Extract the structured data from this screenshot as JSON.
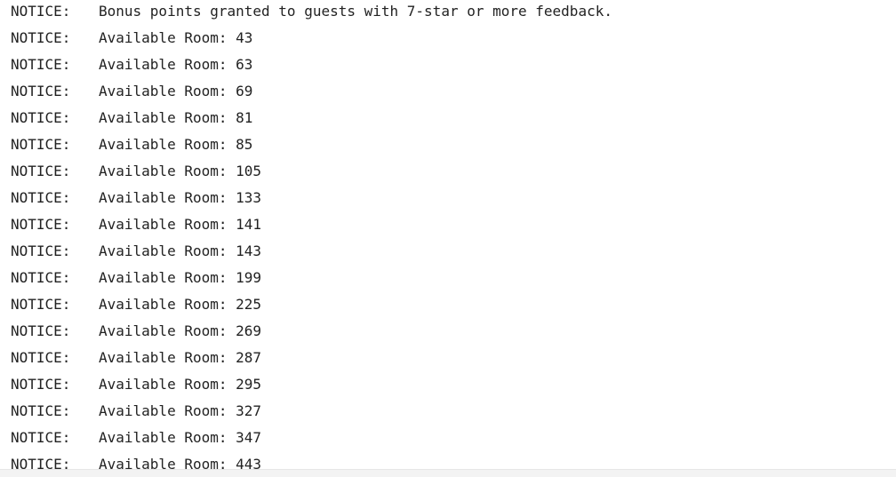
{
  "log": {
    "lines": [
      {
        "level": "NOTICE:",
        "message": "Bonus points granted to guests with 7-star or more feedback."
      },
      {
        "level": "NOTICE:",
        "message": "Available Room: 43"
      },
      {
        "level": "NOTICE:",
        "message": "Available Room: 63"
      },
      {
        "level": "NOTICE:",
        "message": "Available Room: 69"
      },
      {
        "level": "NOTICE:",
        "message": "Available Room: 81"
      },
      {
        "level": "NOTICE:",
        "message": "Available Room: 85"
      },
      {
        "level": "NOTICE:",
        "message": "Available Room: 105"
      },
      {
        "level": "NOTICE:",
        "message": "Available Room: 133"
      },
      {
        "level": "NOTICE:",
        "message": "Available Room: 141"
      },
      {
        "level": "NOTICE:",
        "message": "Available Room: 143"
      },
      {
        "level": "NOTICE:",
        "message": "Available Room: 199"
      },
      {
        "level": "NOTICE:",
        "message": "Available Room: 225"
      },
      {
        "level": "NOTICE:",
        "message": "Available Room: 269"
      },
      {
        "level": "NOTICE:",
        "message": "Available Room: 287"
      },
      {
        "level": "NOTICE:",
        "message": "Available Room: 295"
      },
      {
        "level": "NOTICE:",
        "message": "Available Room: 327"
      },
      {
        "level": "NOTICE:",
        "message": "Available Room: 347"
      },
      {
        "level": "NOTICE:",
        "message": "Available Room: 443"
      }
    ]
  }
}
